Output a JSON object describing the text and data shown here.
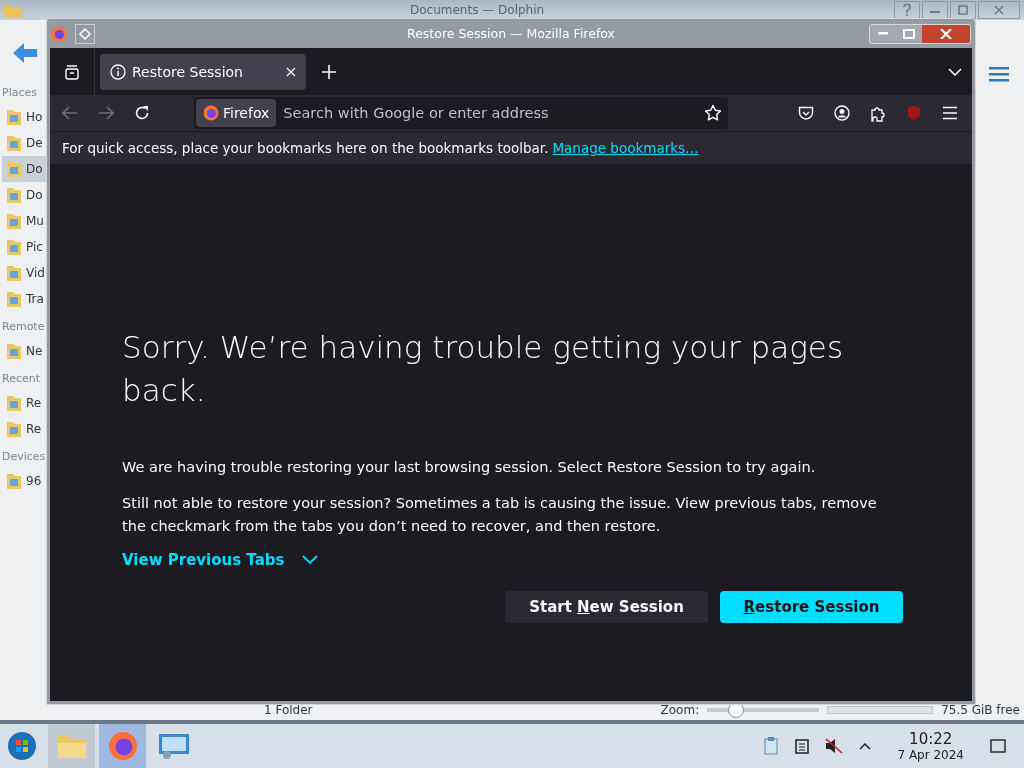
{
  "background_window": {
    "title": "Documents — Dolphin",
    "sidebar": [
      {
        "kind": "heading",
        "label": "Places"
      },
      {
        "kind": "item",
        "label": "Ho",
        "selected": false
      },
      {
        "kind": "item",
        "label": "De",
        "selected": false
      },
      {
        "kind": "item",
        "label": "Do",
        "selected": true
      },
      {
        "kind": "item",
        "label": "Do",
        "selected": false
      },
      {
        "kind": "item",
        "label": "Mu",
        "selected": false
      },
      {
        "kind": "item",
        "label": "Pic",
        "selected": false
      },
      {
        "kind": "item",
        "label": "Vid",
        "selected": false
      },
      {
        "kind": "item",
        "label": "Tra",
        "selected": false
      },
      {
        "kind": "heading",
        "label": "Remote"
      },
      {
        "kind": "item",
        "label": "Ne",
        "selected": false
      },
      {
        "kind": "heading",
        "label": "Recent"
      },
      {
        "kind": "item",
        "label": "Re",
        "selected": false
      },
      {
        "kind": "item",
        "label": "Re",
        "selected": false
      },
      {
        "kind": "heading",
        "label": "Devices"
      },
      {
        "kind": "item",
        "label": "96",
        "selected": false
      }
    ],
    "status_bar": {
      "folder_count": "1 Folder",
      "zoom_label": "Zoom:",
      "zoom": {
        "level": 0.25
      },
      "free_space": "75.5 GiB free"
    }
  },
  "window": {
    "title": "Restore Session — Mozilla Firefox"
  },
  "tabs": [
    {
      "label": "Restore Session",
      "selected": true
    }
  ],
  "address_bar": {
    "identity_label": "Firefox",
    "placeholder": "Search with Google or enter address"
  },
  "bookmarks_bar": {
    "text": "For quick access, place your bookmarks here on the bookmarks toolbar.",
    "link": "Manage bookmarks…"
  },
  "content": {
    "heading": "Sorry. We’re having trouble getting your pages back.",
    "paragraphs": [
      "We are having trouble restoring your last browsing session. Select Restore Session to try again.",
      "Still not able to restore your session? Sometimes a tab is causing the issue. View previous tabs, remove the checkmark from the tabs you don’t need to recover, and then restore."
    ],
    "toggle": {
      "label": "View Previous Tabs",
      "expanded": false
    },
    "buttons": [
      {
        "kind": "secondary",
        "before": "Start ",
        "key": "N",
        "after": "ew Session"
      },
      {
        "kind": "primary",
        "key": "R",
        "after": "estore Session"
      }
    ]
  },
  "taskbar": {
    "apps": [
      {
        "kind": "files",
        "selected": false
      },
      {
        "kind": "firefox",
        "selected": true
      },
      {
        "kind": "monitor",
        "selected": false
      }
    ],
    "time": "10:22",
    "date": "7 Apr 2024"
  }
}
